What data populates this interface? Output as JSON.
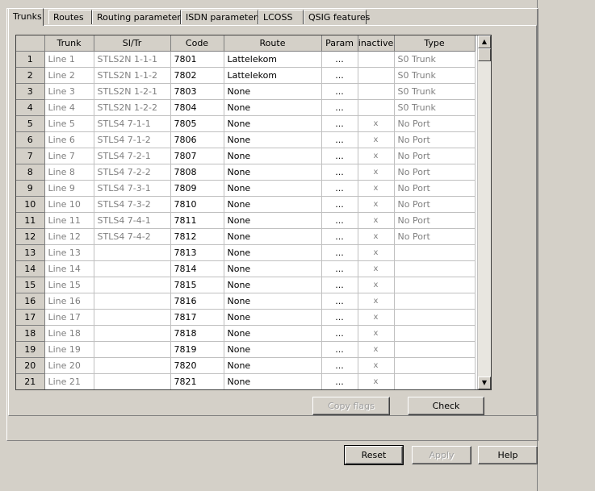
{
  "tabs": [
    {
      "label": "Trunks",
      "active": true
    },
    {
      "label": "Routes"
    },
    {
      "label": "Routing parameters"
    },
    {
      "label": "ISDN parameters"
    },
    {
      "label": "LCOSS"
    },
    {
      "label": "QSIG features"
    }
  ],
  "grid": {
    "columns": [
      "",
      "Trunk",
      "SI/Tr",
      "Code",
      "Route",
      "Param",
      "inactive",
      "Type"
    ],
    "rows": [
      [
        "1",
        "Line 1",
        "STLS2N  1-1-1",
        "7801",
        "Lattelekom",
        "...",
        "",
        "S0 Trunk"
      ],
      [
        "2",
        "Line 2",
        "STLS2N  1-1-2",
        "7802",
        "Lattelekom",
        "...",
        "",
        "S0 Trunk"
      ],
      [
        "3",
        "Line 3",
        "STLS2N  1-2-1",
        "7803",
        "None",
        "...",
        "",
        "S0 Trunk"
      ],
      [
        "4",
        "Line 4",
        "STLS2N  1-2-2",
        "7804",
        "None",
        "...",
        "",
        "S0 Trunk"
      ],
      [
        "5",
        "Line 5",
        "STLS4  7-1-1",
        "7805",
        "None",
        "...",
        "x",
        "No Port"
      ],
      [
        "6",
        "Line 6",
        "STLS4  7-1-2",
        "7806",
        "None",
        "...",
        "x",
        "No Port"
      ],
      [
        "7",
        "Line 7",
        "STLS4  7-2-1",
        "7807",
        "None",
        "...",
        "x",
        "No Port"
      ],
      [
        "8",
        "Line 8",
        "STLS4  7-2-2",
        "7808",
        "None",
        "...",
        "x",
        "No Port"
      ],
      [
        "9",
        "Line 9",
        "STLS4  7-3-1",
        "7809",
        "None",
        "...",
        "x",
        "No Port"
      ],
      [
        "10",
        "Line 10",
        "STLS4  7-3-2",
        "7810",
        "None",
        "...",
        "x",
        "No Port"
      ],
      [
        "11",
        "Line 11",
        "STLS4  7-4-1",
        "7811",
        "None",
        "...",
        "x",
        "No Port"
      ],
      [
        "12",
        "Line 12",
        "STLS4  7-4-2",
        "7812",
        "None",
        "...",
        "x",
        "No Port"
      ],
      [
        "13",
        "Line 13",
        "",
        "7813",
        "None",
        "...",
        "x",
        ""
      ],
      [
        "14",
        "Line 14",
        "",
        "7814",
        "None",
        "...",
        "x",
        ""
      ],
      [
        "15",
        "Line 15",
        "",
        "7815",
        "None",
        "...",
        "x",
        ""
      ],
      [
        "16",
        "Line 16",
        "",
        "7816",
        "None",
        "...",
        "x",
        ""
      ],
      [
        "17",
        "Line 17",
        "",
        "7817",
        "None",
        "...",
        "x",
        ""
      ],
      [
        "18",
        "Line 18",
        "",
        "7818",
        "None",
        "...",
        "x",
        ""
      ],
      [
        "19",
        "Line 19",
        "",
        "7819",
        "None",
        "...",
        "x",
        ""
      ],
      [
        "20",
        "Line 20",
        "",
        "7820",
        "None",
        "...",
        "x",
        ""
      ],
      [
        "21",
        "Line 21",
        "",
        "7821",
        "None",
        "...",
        "x",
        ""
      ]
    ]
  },
  "scrollbar": {
    "up_icon": "arrow-up",
    "down_icon": "arrow-down"
  },
  "buttons": {
    "copy_flags": "Copy flags",
    "check": "Check",
    "reset": "Reset",
    "apply": "Apply",
    "help": "Help"
  }
}
